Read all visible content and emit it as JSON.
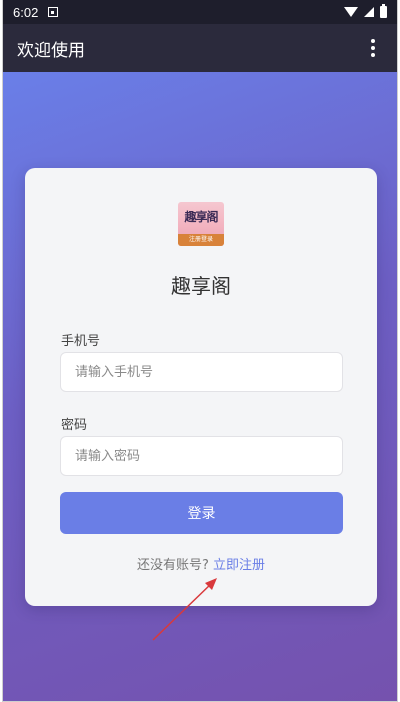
{
  "status_bar": {
    "time": "6:02"
  },
  "app_bar": {
    "title": "欢迎使用"
  },
  "logo": {
    "text": "趣享阁",
    "strip_text": "注册登录"
  },
  "brand": {
    "name": "趣享阁"
  },
  "form": {
    "phone": {
      "label": "手机号",
      "placeholder": "请输入手机号",
      "value": ""
    },
    "password": {
      "label": "密码",
      "placeholder": "请输入密码",
      "value": ""
    },
    "login_label": "登录"
  },
  "register": {
    "prompt": "还没有账号?",
    "link": "立即注册"
  },
  "colors": {
    "accent": "#6a7ee6",
    "app_bar": "#2b2a3c",
    "status_bar": "#1e1e2c",
    "gradient_start": "#6a7fe8",
    "gradient_end": "#7552ae",
    "annotation_arrow": "#d9393c"
  },
  "icons": [
    "notification-icon",
    "wifi-icon",
    "signal-icon",
    "battery-icon",
    "more-vert-icon",
    "app-logo"
  ]
}
